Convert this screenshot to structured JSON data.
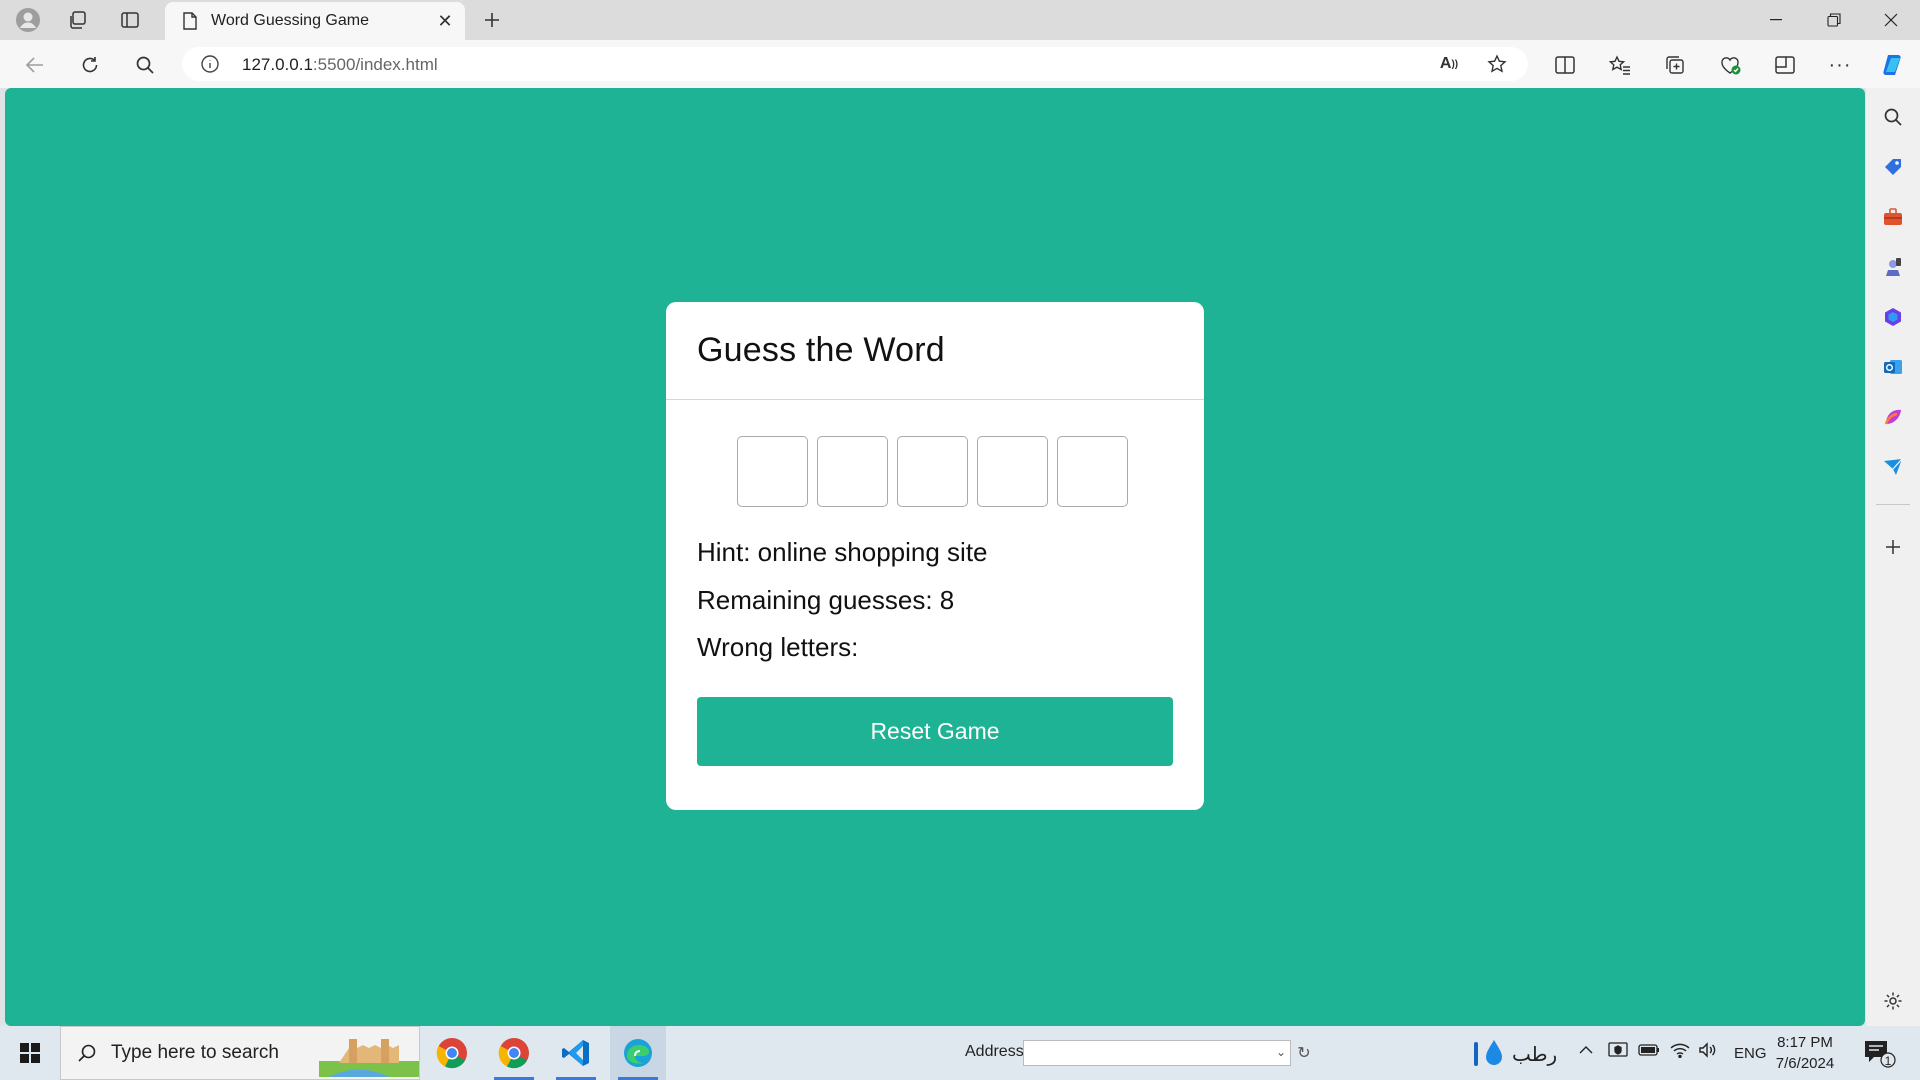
{
  "browser": {
    "tab_title": "Word Guessing Game",
    "url_host": "127.0.0.1",
    "url_rest": ":5500/index.html"
  },
  "game": {
    "title": "Guess the Word",
    "letter_slots": 5,
    "hint": "Hint: online shopping site",
    "remaining": "Remaining guesses: 8",
    "wrong": "Wrong letters:",
    "reset_label": "Reset Game"
  },
  "taskbar": {
    "search_placeholder": "Type here to search",
    "address_label": "Address",
    "weather_text": "رطب",
    "language": "ENG",
    "time": "8:17 PM",
    "date": "7/6/2024",
    "notification_count": "1"
  },
  "colors": {
    "page_background": "#1db394",
    "button": "#1db394"
  },
  "icons": {
    "sidebar": [
      "search-icon",
      "tag-icon",
      "toolbox-icon",
      "games-icon",
      "office-icon",
      "outlook-icon",
      "designer-icon",
      "send-icon",
      "add-icon",
      "settings-icon"
    ]
  }
}
